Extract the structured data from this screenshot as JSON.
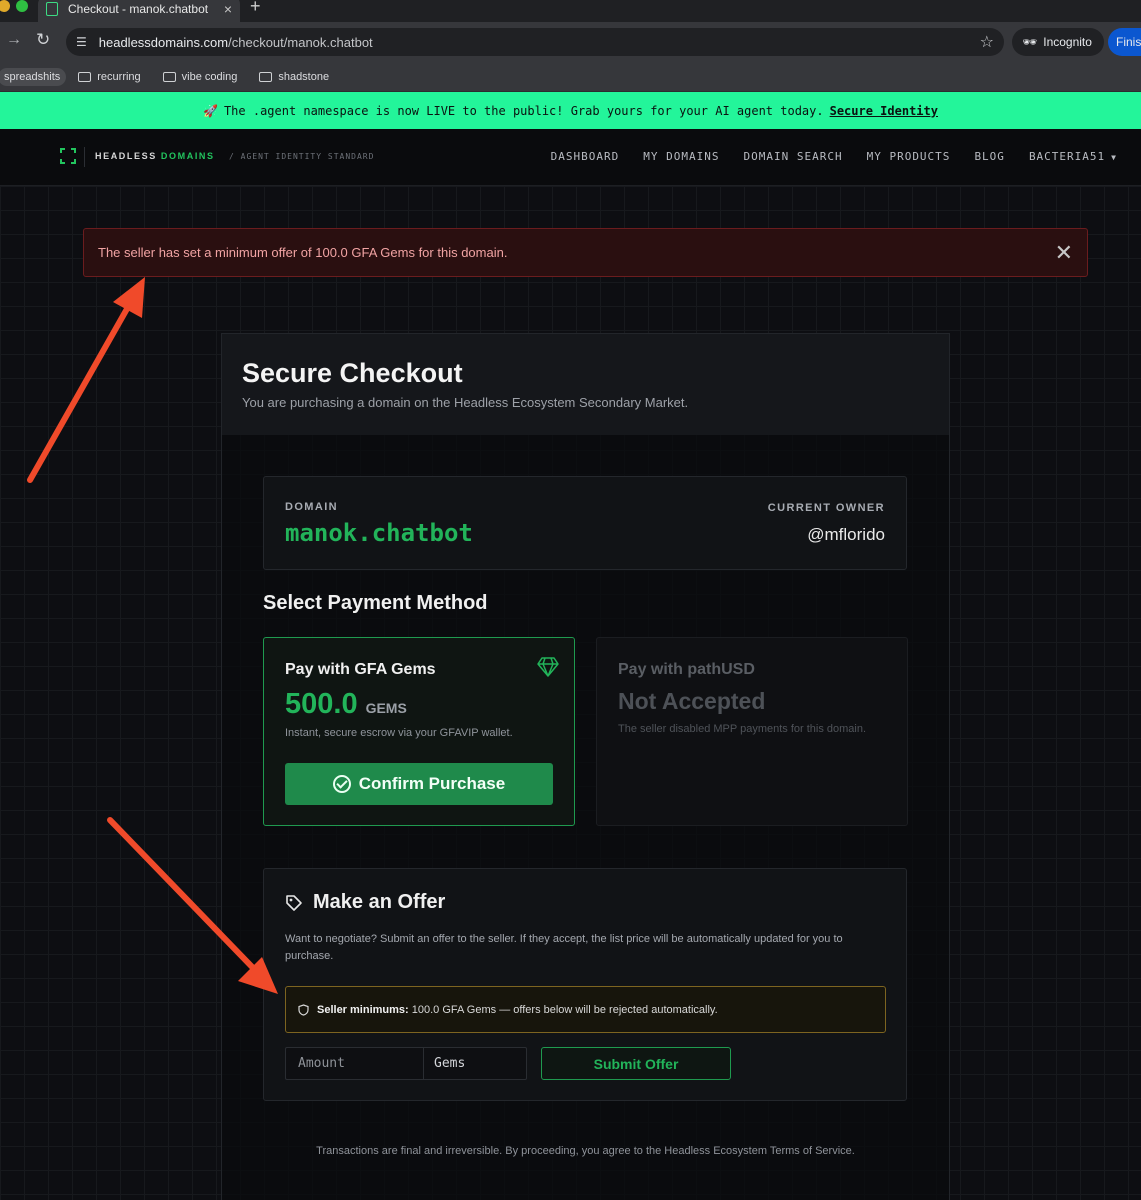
{
  "browser": {
    "tab_title": "Checkout - manok.chatbot",
    "tab_close": "×",
    "new_tab": "+",
    "url_host": "headlessdomains.com",
    "url_path": "/checkout/manok.chatbot",
    "incognito_label": "Incognito",
    "finish_label": "Finis",
    "bookmarks": [
      {
        "label": "spreadshits"
      },
      {
        "label": "recurring"
      },
      {
        "label": "vibe coding"
      },
      {
        "label": "shadstone"
      }
    ]
  },
  "promo": {
    "emoji": "🚀",
    "text": "The .agent namespace is now LIVE to the public! Grab yours for your AI agent today.",
    "link": "Secure Identity"
  },
  "header": {
    "brand_left": "HEADLESS",
    "brand_right": "DOMAINS",
    "tagline": "/ AGENT IDENTITY STANDARD",
    "nav": [
      "DASHBOARD",
      "MY DOMAINS",
      "DOMAIN SEARCH",
      "MY PRODUCTS",
      "BLOG",
      "BACTERIA51"
    ]
  },
  "alert": {
    "message": "The seller has set a minimum offer of 100.0 GFA Gems for this domain."
  },
  "checkout": {
    "title": "Secure Checkout",
    "subtitle": "You are purchasing a domain on the Headless Ecosystem Secondary Market.",
    "domain_label": "DOMAIN",
    "domain_name": "manok.chatbot",
    "owner_label": "CURRENT OWNER",
    "owner": "@mflorido",
    "payment_title": "Select Payment Method",
    "gems": {
      "title": "Pay with GFA Gems",
      "price": "500.0",
      "unit": "GEMS",
      "subtitle": "Instant, secure escrow via your GFAVIP wallet.",
      "button": "Confirm Purchase"
    },
    "usd": {
      "title": "Pay with pathUSD",
      "status": "Not Accepted",
      "subtitle": "The seller disabled MPP payments for this domain."
    },
    "offer": {
      "title": "Make an Offer",
      "description": "Want to negotiate? Submit an offer to the seller. If they accept, the list price will be automatically updated for you to purchase.",
      "min_label": "Seller minimums:",
      "min_text": "100.0 GFA Gems — offers below will be rejected automatically.",
      "amount_placeholder": "Amount",
      "amount_value": "",
      "unit": "Gems",
      "submit": "Submit Offer"
    },
    "footer": "Transactions are final and irreversible. By proceeding, you agree to the Headless Ecosystem Terms of Service."
  },
  "colors": {
    "accent_green": "#22b45a",
    "promo_bg": "#23f59a",
    "alert_bg": "#2a0f10",
    "arrow_red": "#f04a2a"
  }
}
